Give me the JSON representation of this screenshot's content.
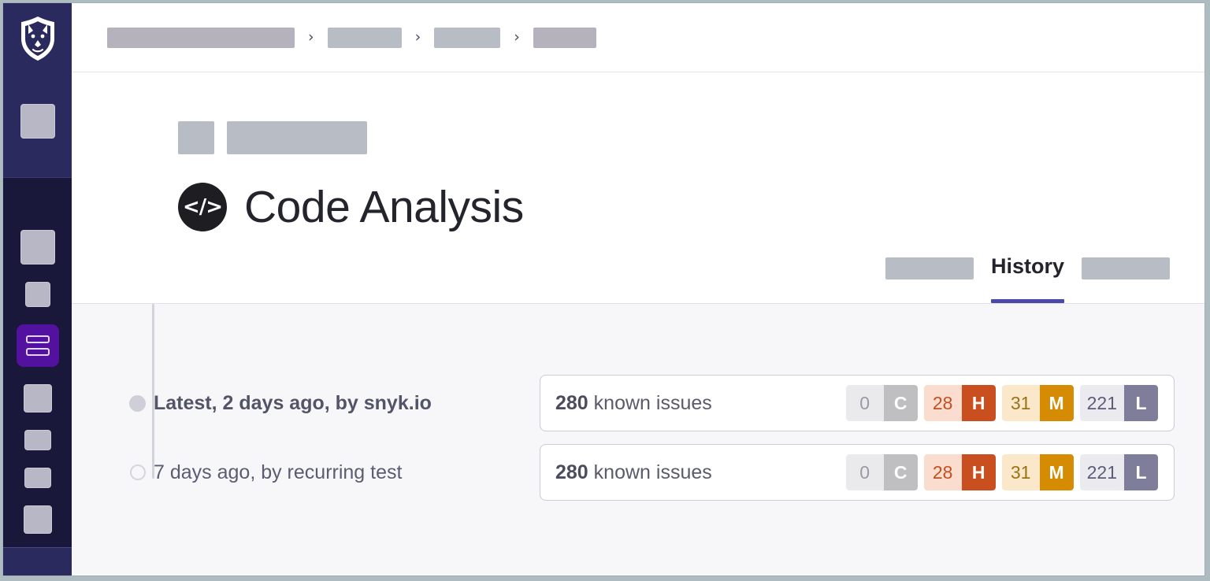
{
  "app": {
    "brand_icon": "snyk-dog-logo",
    "accent_purple": "#52119e",
    "tab_underline_color": "#4c4aa8"
  },
  "breadcrumb": {
    "separator": "›",
    "items": [
      {
        "label": "",
        "redacted": true
      },
      {
        "label": "",
        "redacted": true
      },
      {
        "label": "",
        "redacted": true
      },
      {
        "label": "",
        "redacted": true
      }
    ]
  },
  "header": {
    "tags": [
      {
        "label": "",
        "redacted": true
      },
      {
        "label": "",
        "redacted": true
      }
    ],
    "icon": "code-brackets-icon",
    "icon_glyph": "</>",
    "title": "Code Analysis"
  },
  "tabs": {
    "items": [
      {
        "label": "",
        "redacted": true,
        "active": false
      },
      {
        "label": "History",
        "redacted": false,
        "active": true
      },
      {
        "label": "",
        "redacted": true,
        "active": false
      }
    ]
  },
  "history": {
    "rows": [
      {
        "label": "Latest, 2 days ago, by snyk.io",
        "latest": true,
        "dot": "filled-dot-icon",
        "count": "280",
        "count_suffix": "known issues",
        "severities": [
          {
            "name": "critical",
            "count": "0",
            "letter": "C"
          },
          {
            "name": "high",
            "count": "28",
            "letter": "H"
          },
          {
            "name": "medium",
            "count": "31",
            "letter": "M"
          },
          {
            "name": "low",
            "count": "221",
            "letter": "L"
          }
        ]
      },
      {
        "label": "7 days ago, by recurring test",
        "latest": false,
        "dot": "hollow-dot-icon",
        "count": "280",
        "count_suffix": "known issues",
        "severities": [
          {
            "name": "critical",
            "count": "0",
            "letter": "C"
          },
          {
            "name": "high",
            "count": "28",
            "letter": "H"
          },
          {
            "name": "medium",
            "count": "31",
            "letter": "M"
          },
          {
            "name": "low",
            "count": "221",
            "letter": "L"
          }
        ]
      }
    ]
  }
}
